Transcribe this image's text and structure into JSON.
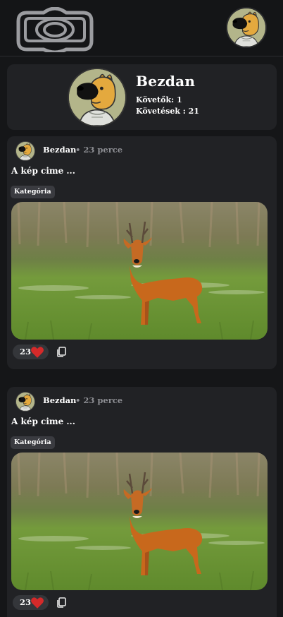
{
  "colors": {
    "background": "#151618",
    "card": "#212225",
    "muted": "#8d8e93",
    "heart": "#d42a2a"
  },
  "header": {
    "logo_icon": "camera-frame-logo-icon",
    "user_avatar_icon": "dog-avatar-icon"
  },
  "profile": {
    "name": "Bezdan",
    "followers": "Követők: 1",
    "following": "Követések : 21"
  },
  "posts": [
    {
      "author": "Bezdan",
      "time": "• 23 perce",
      "title": "A kép cime ...",
      "category": "Kategória",
      "likes": "23",
      "image": "roe-deer-photo"
    },
    {
      "author": "Bezdan",
      "time": "• 23 perce",
      "title": "A kép cime ...",
      "category": "Kategória",
      "likes": "23",
      "image": "roe-deer-photo"
    }
  ]
}
